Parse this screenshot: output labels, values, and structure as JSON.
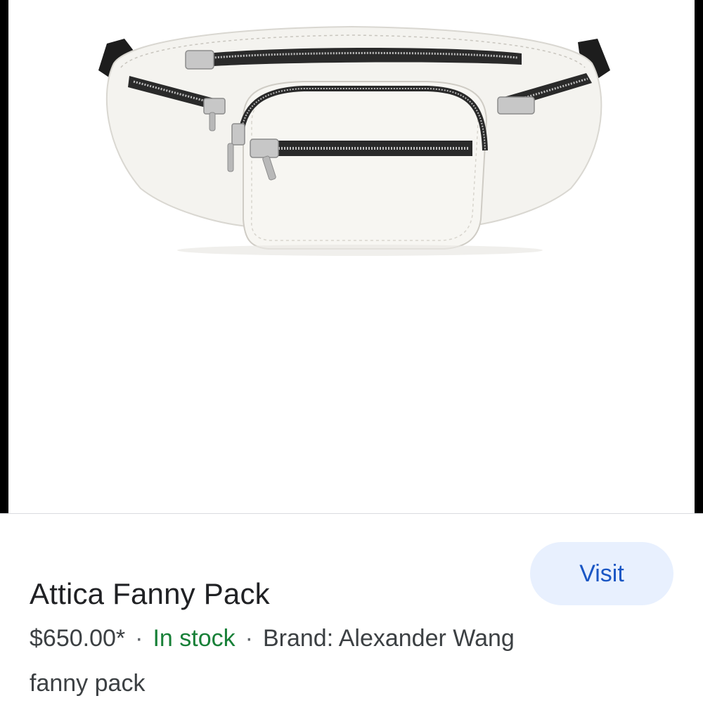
{
  "product": {
    "title": "Attica Fanny Pack",
    "price": "$650.00*",
    "separator": "·",
    "availability": "In stock",
    "brand": "Brand: Alexander Wang",
    "category": "fanny pack",
    "image_alt": "White leather fanny pack with silver zippers"
  },
  "actions": {
    "visit_label": "Visit"
  },
  "colors": {
    "title": "#202124",
    "in_stock": "#188038",
    "visit_text": "#1a56c4",
    "visit_bg": "#e8f0fe"
  },
  "icons": {
    "product_image": "fanny-pack-image"
  }
}
